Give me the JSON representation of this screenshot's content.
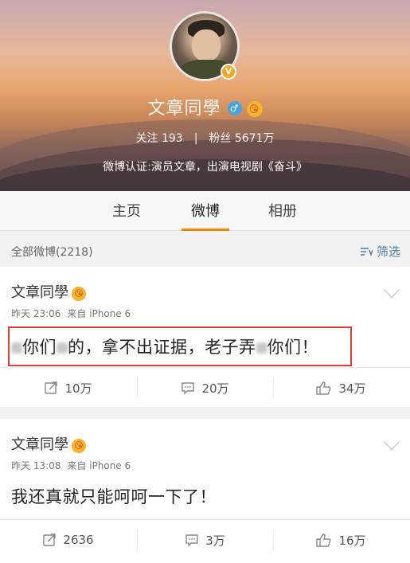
{
  "profile": {
    "name": "文章同學",
    "verified_badge": "V",
    "gender_symbol": "♂",
    "emoji": "😘",
    "follow_label": "关注",
    "follow_count": "193",
    "fans_label": "粉丝",
    "fans_count": "5671万",
    "separator": "|",
    "verification": "微博认证:演员文章，出演电视剧《奋斗》"
  },
  "tabs": [
    {
      "label": "主页",
      "active": false
    },
    {
      "label": "微博",
      "active": true
    },
    {
      "label": "相册",
      "active": false
    }
  ],
  "filter": {
    "all_label": "全部微博(2218)",
    "filter_label": "筛选"
  },
  "posts": [
    {
      "author": "文章同學",
      "time": "昨天 23:06",
      "source": "来自 iPhone 6",
      "text_parts": [
        "你们",
        "的，拿不出证据，老子弄",
        "你们！"
      ],
      "highlighted": true,
      "reposts": "10万",
      "comments": "20万",
      "likes": "34万"
    },
    {
      "author": "文章同學",
      "time": "昨天 13:08",
      "source": "来自 iPhone 6",
      "text": "我还真就只能呵呵一下了！",
      "highlighted": false,
      "reposts": "2636",
      "comments": "3万",
      "likes": "16万"
    }
  ],
  "colors": {
    "accent": "#ff8200",
    "highlight": "#e53935",
    "link": "#507daf"
  }
}
